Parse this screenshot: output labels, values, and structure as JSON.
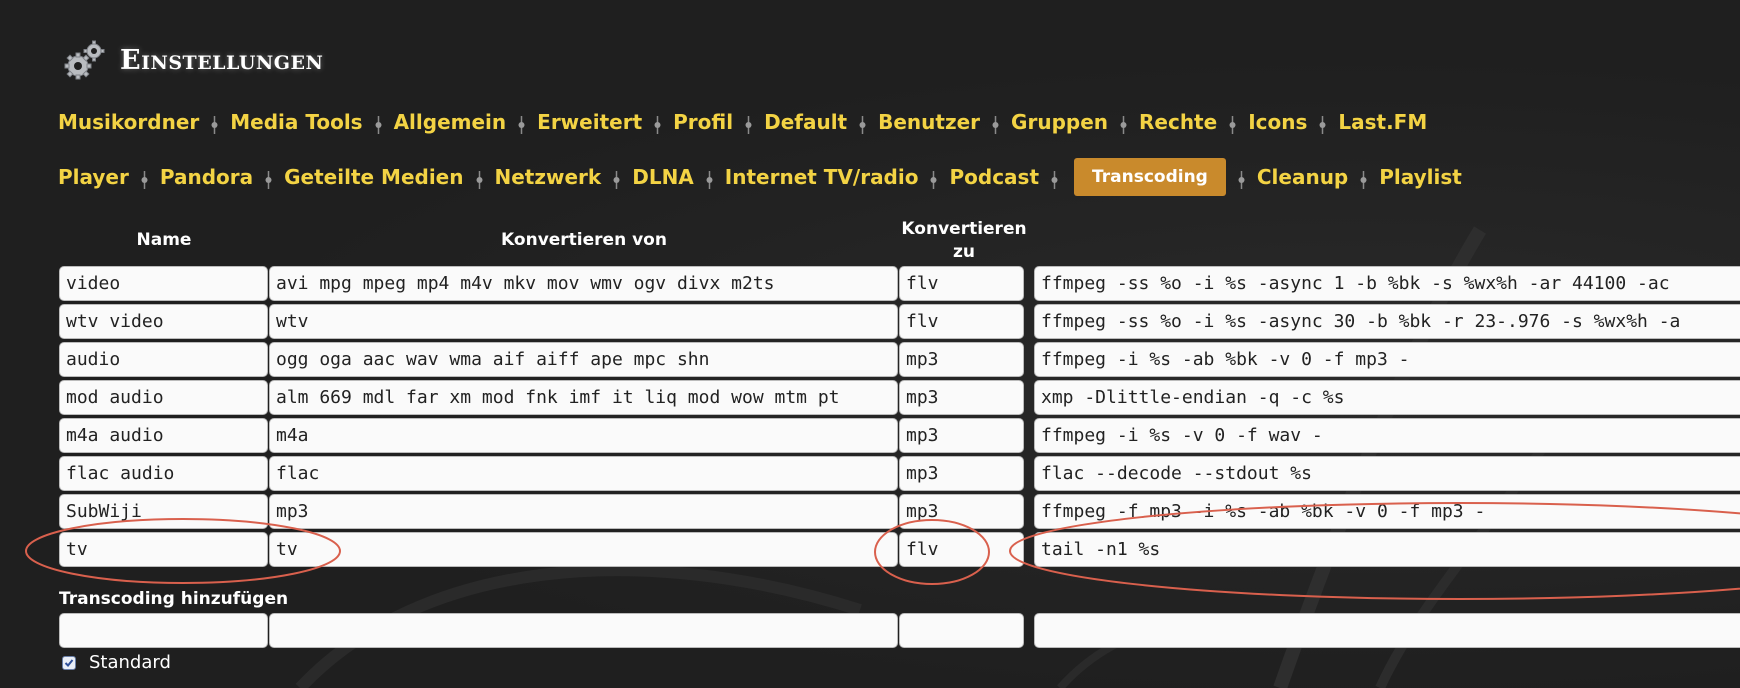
{
  "header": {
    "title": "Einstellungen",
    "icon": "gears-icon"
  },
  "nav_row1": [
    "Musikordner",
    "Media Tools",
    "Allgemein",
    "Erweitert",
    "Profil",
    "Default",
    "Benutzer",
    "Gruppen",
    "Rechte",
    "Icons",
    "Last.FM"
  ],
  "nav_row2": [
    "Player",
    "Pandora",
    "Geteilte Medien",
    "Netzwerk",
    "DLNA",
    "Internet TV/radio",
    "Podcast",
    "Transcoding",
    "Cleanup",
    "Playlist"
  ],
  "active_tab": "Transcoding",
  "colors": {
    "nav": "#f3d344",
    "active_tab_bg": "#c98a2c",
    "annotation": "#d9604d",
    "background": "#1f1f1f"
  },
  "table": {
    "headers": {
      "name": "Name",
      "from": "Konvertieren von",
      "to_line1": "Konvertieren",
      "to_line2": "zu"
    },
    "rows": [
      {
        "name": "video",
        "from": "avi mpg mpeg mp4 m4v mkv mov wmv ogv divx m2ts",
        "to": "flv",
        "cmd": "ffmpeg -ss %o -i %s -async 1 -b %bk -s %wx%h -ar 44100 -ac"
      },
      {
        "name": "wtv video",
        "from": "wtv",
        "to": "flv",
        "cmd": "ffmpeg -ss %o -i %s -async 30 -b %bk -r 23-.976 -s %wx%h -a"
      },
      {
        "name": "audio",
        "from": "ogg oga aac wav wma aif aiff ape mpc shn",
        "to": "mp3",
        "cmd": "ffmpeg -i %s -ab %bk -v 0 -f mp3 -"
      },
      {
        "name": "mod audio",
        "from": "alm 669 mdl far xm mod fnk imf it liq mod wow mtm pt",
        "to": "mp3",
        "cmd": "xmp -Dlittle-endian -q -c %s"
      },
      {
        "name": "m4a audio",
        "from": "m4a",
        "to": "mp3",
        "cmd": "ffmpeg -i %s -v 0 -f wav -"
      },
      {
        "name": "flac audio",
        "from": "flac",
        "to": "mp3",
        "cmd": "flac --decode --stdout %s"
      },
      {
        "name": "SubWiji",
        "from": "mp3",
        "to": "mp3",
        "cmd": "ffmpeg -f mp3 -i %s -ab %bk -v 0 -f mp3 -"
      },
      {
        "name": "tv",
        "from": "tv",
        "to": "flv",
        "cmd": "tail -n1 %s"
      }
    ]
  },
  "add_section": {
    "title": "Transcoding hinzufügen",
    "name": "",
    "from": "",
    "to": "",
    "cmd": "",
    "checkbox_label": "Standard",
    "checkbox_checked": true
  }
}
